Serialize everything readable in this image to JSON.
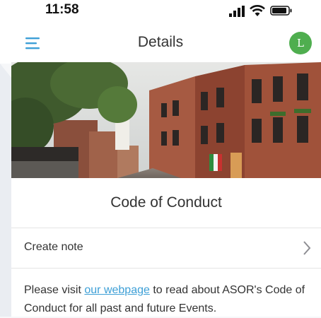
{
  "status_bar": {
    "time": "11:58"
  },
  "nav": {
    "title": "Details",
    "avatar_initial": "L",
    "avatar_color": "#4fae4f",
    "menu_color": "#3d9fd6"
  },
  "hero_image": {
    "description_icon": "street-photo"
  },
  "section": {
    "title": "Code of Conduct"
  },
  "note_row": {
    "label": "Create note"
  },
  "description": {
    "prefix": "Please visit ",
    "link_text": "our webpage",
    "suffix": " to read about ASOR's Code of Conduct for all past and future Events."
  }
}
